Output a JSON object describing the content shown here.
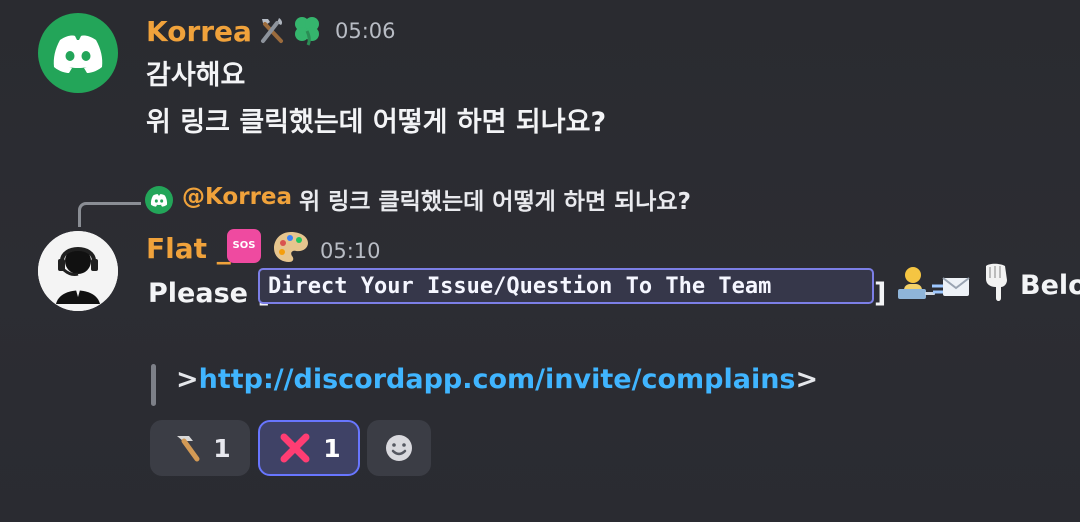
{
  "messages": [
    {
      "author": "Korrea",
      "time": "05:06",
      "lines": [
        "감사해요",
        "위 링크 클릭했는데 어떻게 하면 되나요?"
      ]
    },
    {
      "author": "Flat _",
      "time": "05:10",
      "reply": {
        "mention": "@Korrea",
        "text": "위 링크 클릭했는데 어떻게 하면 되나요?"
      },
      "content": {
        "prefix": "Please [",
        "code": "Direct Your Issue/Question To The Team",
        "suffix": "]",
        "trailing_text": "Belo",
        "quote_prefix": ">",
        "quote_link": "http://discordapp.com/invite/complains",
        "quote_suffix": ">"
      },
      "reactions": [
        {
          "emoji": "hammer",
          "count": "1"
        },
        {
          "emoji": "cross-mark",
          "count": "1",
          "active": true
        },
        {
          "emoji": "add-reaction"
        }
      ]
    }
  ],
  "icons": {
    "first_message_avatar": "discord-logo",
    "second_message_avatar": "headset-person",
    "first_author_badges": [
      "hammer-wrench",
      "four-leaf-clover"
    ],
    "second_author_badges": [
      "sos-button",
      "palette"
    ],
    "inline_emojis": [
      "technologist",
      "envelope-with-arrow",
      "point-down-hand"
    ]
  },
  "colors": {
    "background": "#2b2c31",
    "username": "#f0a23b",
    "discord_green": "#23a559",
    "link": "#40b5ff",
    "code_border": "#7c7fe6",
    "active_reaction": "#6876ff"
  }
}
